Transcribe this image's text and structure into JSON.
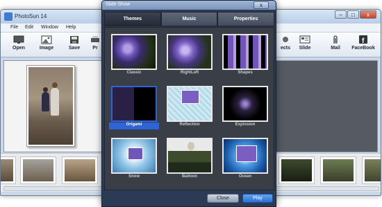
{
  "main_window": {
    "title": "PhotoSun 14",
    "controls": {
      "minimize": "–",
      "maximize": "□",
      "close": "x"
    },
    "menu": [
      "File",
      "Edit",
      "Window",
      "Help"
    ],
    "toolbar_left": [
      {
        "label": "Open",
        "icon": "monitor-icon"
      },
      {
        "label": "Image",
        "icon": "image-icon"
      },
      {
        "label": "Save",
        "icon": "save-icon"
      },
      {
        "label": "Pr",
        "icon": "print-icon"
      }
    ],
    "toolbar_right": [
      {
        "label": "ects",
        "icon": "effects-icon"
      },
      {
        "label": "Slide",
        "icon": "slideshow-icon"
      },
      {
        "label": "Mail",
        "icon": "paperclip-icon"
      },
      {
        "label": "FaceBook",
        "icon": "facebook-icon"
      }
    ]
  },
  "dialog": {
    "title": "Slide Show",
    "close_glyph": "x",
    "tabs": [
      "Themes",
      "Music",
      "Properties"
    ],
    "active_tab": "Themes",
    "themes": [
      {
        "label": "Classic"
      },
      {
        "label": "RightLeft"
      },
      {
        "label": "Shapes"
      },
      {
        "label": "Origami",
        "selected": true
      },
      {
        "label": "Reflection"
      },
      {
        "label": "Explosion"
      },
      {
        "label": "Snow"
      },
      {
        "label": "Balloon"
      },
      {
        "label": "Ocean"
      }
    ],
    "buttons": {
      "close": "Close",
      "play": "Play"
    }
  },
  "colors": {
    "selection": "#2f63d8",
    "dialog_bg": "#2b3a55",
    "play_button": "#2d6fd2"
  }
}
